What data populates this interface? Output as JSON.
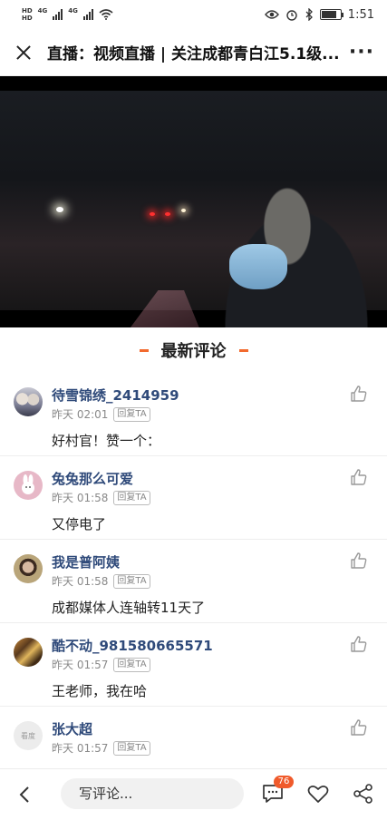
{
  "status_bar": {
    "hd1": "HD",
    "hd2": "HD",
    "net1": "4G",
    "net2": "4G",
    "battery_level": 0.85,
    "time": "1:51"
  },
  "header": {
    "title": "直播：视频直播 | 关注成都青白江5.1级...",
    "more": "···"
  },
  "section": {
    "title": "最新评论"
  },
  "comments": [
    {
      "user": "待雪锦绣_2414959",
      "time": "昨天 02:01",
      "reply": "回复TA",
      "text": "好村官！赞一个："
    },
    {
      "user": "兔兔那么可爱",
      "time": "昨天 01:58",
      "reply": "回复TA",
      "text": "又停电了"
    },
    {
      "user": "我是普阿姨",
      "time": "昨天 01:58",
      "reply": "回复TA",
      "text": "成都媒体人连轴转11天了"
    },
    {
      "user": "酷不动_981580665571",
      "time": "昨天 01:57",
      "reply": "回复TA",
      "text": "王老师，我在哈"
    },
    {
      "user": "张大超",
      "time": "昨天 01:57",
      "reply": "回复TA",
      "text": "",
      "avatar_text": "看度"
    }
  ],
  "bottom_bar": {
    "input_placeholder": "写评论...",
    "comment_count": "76"
  },
  "colors": {
    "accent": "#f26a2e",
    "username": "#2f4a7a",
    "badge": "#f05a2b"
  }
}
